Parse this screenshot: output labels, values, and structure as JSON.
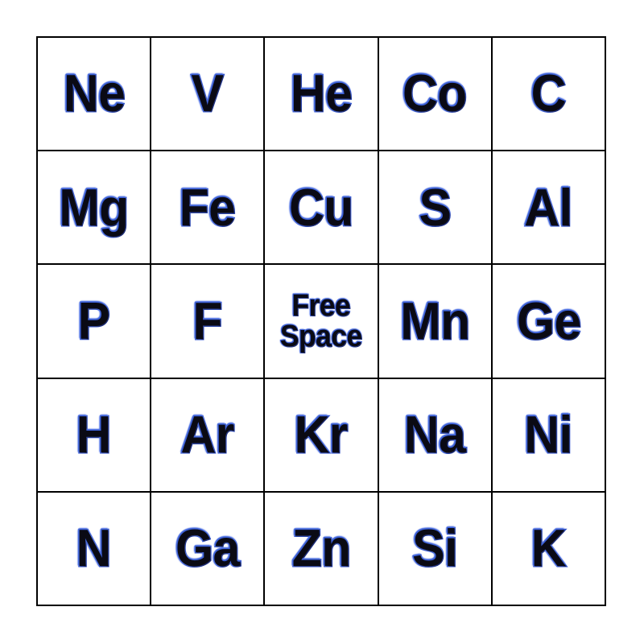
{
  "card": {
    "type": "bingo-card",
    "columns": 5,
    "rows": 5,
    "background_color": "#ffffff",
    "cell_background_color": "#ffffff",
    "border_color": "#000000",
    "text_fill_color": "#0a0a14",
    "text_outline_color": "#2f52cc",
    "free_space_label": "Free\nSpace",
    "cells": [
      {
        "id": "cell-r1c1",
        "label": "Ne",
        "row": 1,
        "col": 1,
        "free_space": false
      },
      {
        "id": "cell-r1c2",
        "label": "V",
        "row": 1,
        "col": 2,
        "free_space": false
      },
      {
        "id": "cell-r1c3",
        "label": "He",
        "row": 1,
        "col": 3,
        "free_space": false
      },
      {
        "id": "cell-r1c4",
        "label": "Co",
        "row": 1,
        "col": 4,
        "free_space": false
      },
      {
        "id": "cell-r1c5",
        "label": "C",
        "row": 1,
        "col": 5,
        "free_space": false
      },
      {
        "id": "cell-r2c1",
        "label": "Mg",
        "row": 2,
        "col": 1,
        "free_space": false
      },
      {
        "id": "cell-r2c2",
        "label": "Fe",
        "row": 2,
        "col": 2,
        "free_space": false
      },
      {
        "id": "cell-r2c3",
        "label": "Cu",
        "row": 2,
        "col": 3,
        "free_space": false
      },
      {
        "id": "cell-r2c4",
        "label": "S",
        "row": 2,
        "col": 4,
        "free_space": false
      },
      {
        "id": "cell-r2c5",
        "label": "Al",
        "row": 2,
        "col": 5,
        "free_space": false
      },
      {
        "id": "cell-r3c1",
        "label": "P",
        "row": 3,
        "col": 1,
        "free_space": false
      },
      {
        "id": "cell-r3c2",
        "label": "F",
        "row": 3,
        "col": 2,
        "free_space": false
      },
      {
        "id": "cell-r3c3",
        "label": "Free\nSpace",
        "row": 3,
        "col": 3,
        "free_space": true
      },
      {
        "id": "cell-r3c4",
        "label": "Mn",
        "row": 3,
        "col": 4,
        "free_space": false
      },
      {
        "id": "cell-r3c5",
        "label": "Ge",
        "row": 3,
        "col": 5,
        "free_space": false
      },
      {
        "id": "cell-r4c1",
        "label": "H",
        "row": 4,
        "col": 1,
        "free_space": false
      },
      {
        "id": "cell-r4c2",
        "label": "Ar",
        "row": 4,
        "col": 2,
        "free_space": false
      },
      {
        "id": "cell-r4c3",
        "label": "Kr",
        "row": 4,
        "col": 3,
        "free_space": false
      },
      {
        "id": "cell-r4c4",
        "label": "Na",
        "row": 4,
        "col": 4,
        "free_space": false
      },
      {
        "id": "cell-r4c5",
        "label": "Ni",
        "row": 4,
        "col": 5,
        "free_space": false
      },
      {
        "id": "cell-r5c1",
        "label": "N",
        "row": 5,
        "col": 1,
        "free_space": false
      },
      {
        "id": "cell-r5c2",
        "label": "Ga",
        "row": 5,
        "col": 2,
        "free_space": false
      },
      {
        "id": "cell-r5c3",
        "label": "Zn",
        "row": 5,
        "col": 3,
        "free_space": false
      },
      {
        "id": "cell-r5c4",
        "label": "Si",
        "row": 5,
        "col": 4,
        "free_space": false
      },
      {
        "id": "cell-r5c5",
        "label": "K",
        "row": 5,
        "col": 5,
        "free_space": false
      }
    ]
  }
}
